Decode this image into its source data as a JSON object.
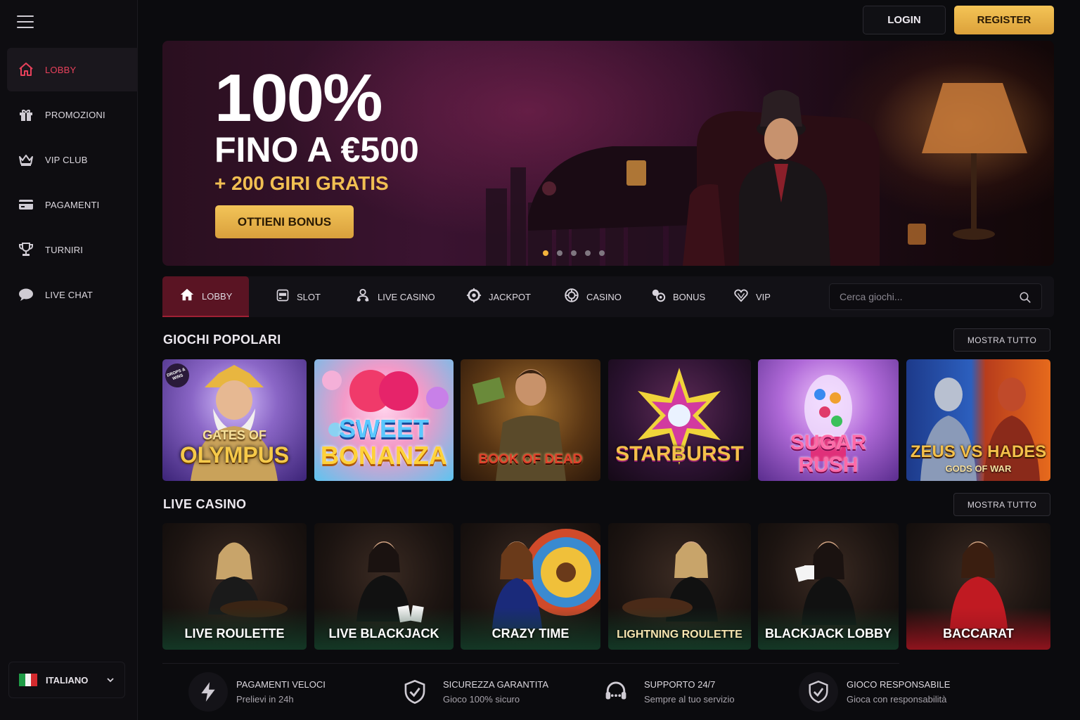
{
  "sidebar": {
    "items": [
      {
        "label": "LOBBY",
        "icon": "home-icon"
      },
      {
        "label": "PROMOZIONI",
        "icon": "gift-icon"
      },
      {
        "label": "VIP CLUB",
        "icon": "crown-icon"
      },
      {
        "label": "PAGAMENTI",
        "icon": "card-icon"
      },
      {
        "label": "TURNIRI",
        "icon": "trophy-icon"
      },
      {
        "label": "LIVE CHAT",
        "icon": "chat-icon"
      }
    ],
    "language": "ITALIANO"
  },
  "header": {
    "login": "LOGIN",
    "register": "REGISTER"
  },
  "hero": {
    "headline": "100%",
    "line2": "FINO A €500",
    "line3": "+ 200 GIRI GRATIS",
    "cta": "OTTIENI BONUS",
    "slides": 5,
    "active_slide": 1
  },
  "categories": [
    {
      "label": "LOBBY",
      "icon": "home-icon"
    },
    {
      "label": "SLOT",
      "icon": "slot-icon"
    },
    {
      "label": "LIVE CASINO",
      "icon": "dealer-icon"
    },
    {
      "label": "JACKPOT",
      "icon": "jackpot-icon"
    },
    {
      "label": "CASINO",
      "icon": "chip-icon"
    },
    {
      "label": "BONUS",
      "icon": "bonus-icon"
    },
    {
      "label": "VIP",
      "icon": "diamond-heart-icon"
    }
  ],
  "search": {
    "placeholder": "Cerca giochi..."
  },
  "popular": {
    "title": "GIOCHI POPOLARI",
    "show_all": "MOSTRA TUTTO",
    "games": [
      {
        "line1": "GATES OF",
        "line2": "OLYMPUS",
        "badge": "DROPS & WINS"
      },
      {
        "line1": "SWEET",
        "line2": "BONANZA"
      },
      {
        "line1": "BOOK OF DEAD"
      },
      {
        "line1": "STARBURST"
      },
      {
        "line1": "SUGAR",
        "line2": "RUSH"
      },
      {
        "line1": "ZEUS VS HADES",
        "line2": "GODS OF WAR"
      }
    ]
  },
  "live": {
    "title": "LIVE CASINO",
    "show_all": "MOSTRA TUTTO",
    "games": [
      "LIVE ROULETTE",
      "LIVE BLACKJACK",
      "CRAZY TIME",
      "LIGHTNING ROULETTE",
      "BLACKJACK LOBBY",
      "BACCARAT"
    ]
  },
  "features": [
    {
      "title": "PAGAMENTI VELOCI",
      "sub": "Prelievi in 24h",
      "icon": "lightning-icon"
    },
    {
      "title": "SICUREZZA GARANTITA",
      "sub": "Gioco 100% sicuro",
      "icon": "shield-check-icon"
    },
    {
      "title": "SUPPORTO 24/7",
      "sub": "Sempre al tuo servizio",
      "icon": "headset-icon"
    },
    {
      "title": "GIOCO RESPONSABILE",
      "sub": "Gioca con responsabilità",
      "icon": "shield-check-icon"
    }
  ],
  "colors": {
    "accent": "#e8415b",
    "gold": "#f1bf52",
    "active_tab": "#5a1423"
  }
}
